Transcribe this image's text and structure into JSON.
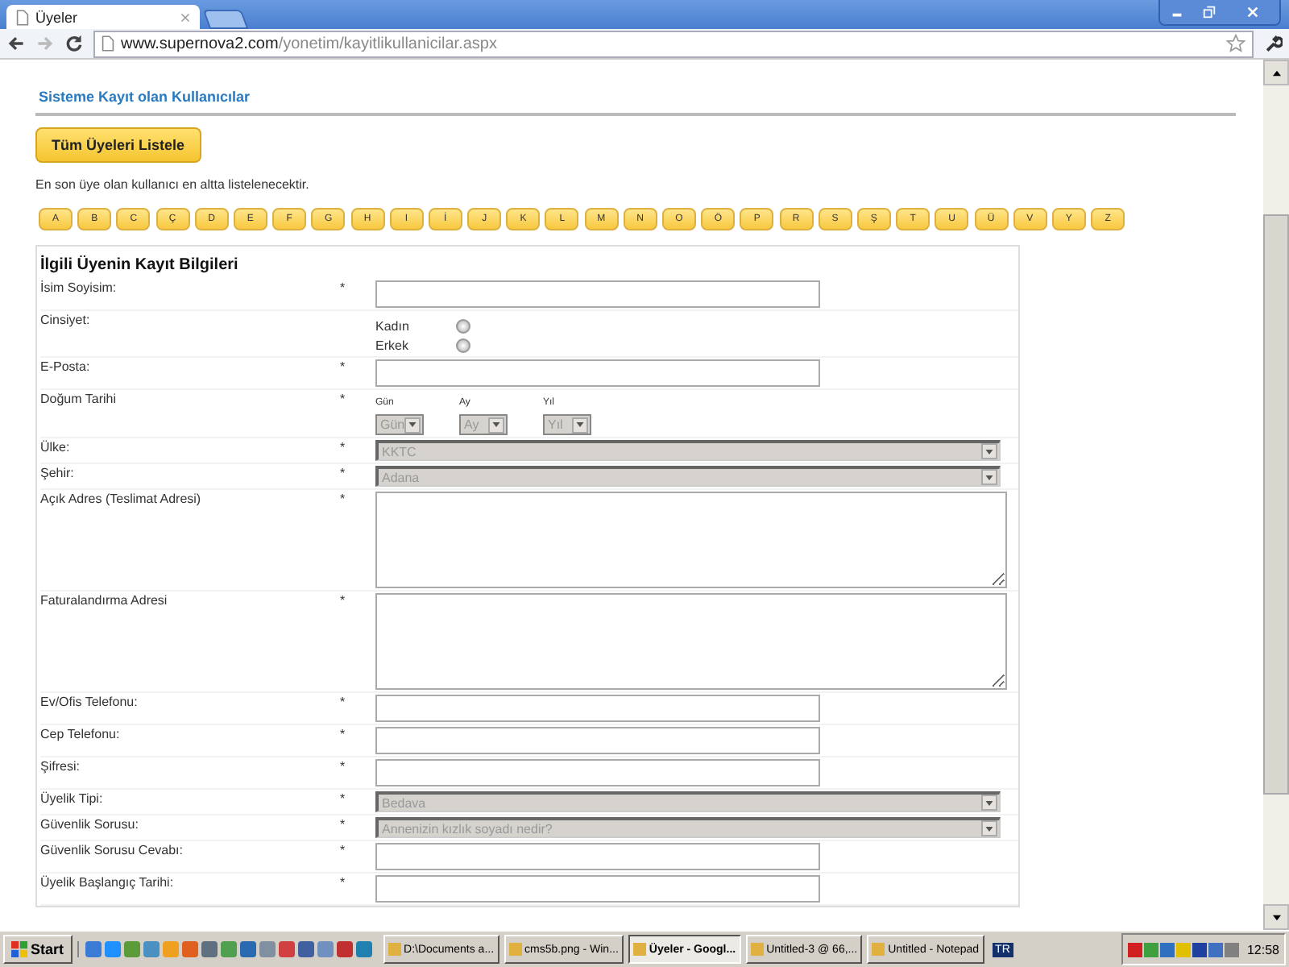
{
  "browser": {
    "tab_title": "Üyeler",
    "url_host": "www.supernova2.com",
    "url_path": "/yonetim/kayitlikullanicilar.aspx"
  },
  "page": {
    "heading": "Sisteme Kayıt olan Kullanıcılar",
    "list_all_button": "Tüm Üyeleri Listele",
    "note": "En son üye olan kullanıcı en altta listelenecektir.",
    "letters": [
      "A",
      "B",
      "C",
      "Ç",
      "D",
      "E",
      "F",
      "G",
      "H",
      "I",
      "İ",
      "J",
      "K",
      "L",
      "M",
      "N",
      "O",
      "Ö",
      "P",
      "R",
      "S",
      "Ş",
      "T",
      "U",
      "Ü",
      "V",
      "Y",
      "Z"
    ]
  },
  "form": {
    "title": "İlgili Üyenin Kayıt Bilgileri",
    "rows": [
      {
        "kind": "text",
        "label": "İsim Soyisim:",
        "mark": "*"
      },
      {
        "kind": "radio",
        "label": "Cinsiyet:",
        "options": [
          {
            "label": "Kadın",
            "selected": false
          },
          {
            "label": "Erkek",
            "selected": false
          }
        ]
      },
      {
        "kind": "text",
        "label": "E-Posta:",
        "mark": "*"
      },
      {
        "kind": "date",
        "label": "Doğum Tarihi",
        "mark": "*",
        "parts": [
          {
            "label": "Gün",
            "value": "Gün"
          },
          {
            "label": "Ay",
            "value": "Ay"
          },
          {
            "label": "Yıl",
            "value": "Yıl"
          }
        ]
      },
      {
        "kind": "select",
        "label": "Ülke:",
        "mark": "*",
        "value": "KKTC"
      },
      {
        "kind": "select",
        "label": "Şehir:",
        "mark": "*",
        "value": "Adana"
      },
      {
        "kind": "textarea",
        "label": "Açık Adres (Teslimat Adresi)",
        "mark": "*"
      },
      {
        "kind": "textarea",
        "label": "Faturalandırma Adresi",
        "mark": "*"
      },
      {
        "kind": "text",
        "label": "Ev/Ofis Telefonu:",
        "mark": "*"
      },
      {
        "kind": "text",
        "label": "Cep Telefonu:",
        "mark": "*"
      },
      {
        "kind": "text",
        "label": "Şifresi:",
        "mark": "*"
      },
      {
        "kind": "select",
        "label": "Üyelik Tipi:",
        "mark": "*",
        "value": "Bedava"
      },
      {
        "kind": "select",
        "label": "Güvenlik Sorusu:",
        "mark": "*",
        "value": "Annenizin kızlık soyadı nedir?"
      },
      {
        "kind": "text",
        "label": "Güvenlik Sorusu Cevabı:",
        "mark": "*"
      },
      {
        "kind": "text",
        "label": "Üyelik Başlangıç Tarihi:",
        "mark": "*"
      }
    ]
  },
  "taskbar": {
    "start": "Start",
    "tasks": [
      {
        "label": "D:\\Documents a...",
        "selected": false
      },
      {
        "label": "cms5b.png - Win...",
        "selected": false
      },
      {
        "label": "Üyeler - Googl...",
        "selected": true
      },
      {
        "label": "Untitled-3 @ 66,...",
        "selected": false
      },
      {
        "label": "Untitled - Notepad",
        "selected": false
      }
    ],
    "language": "TR",
    "clock": "12:58"
  }
}
